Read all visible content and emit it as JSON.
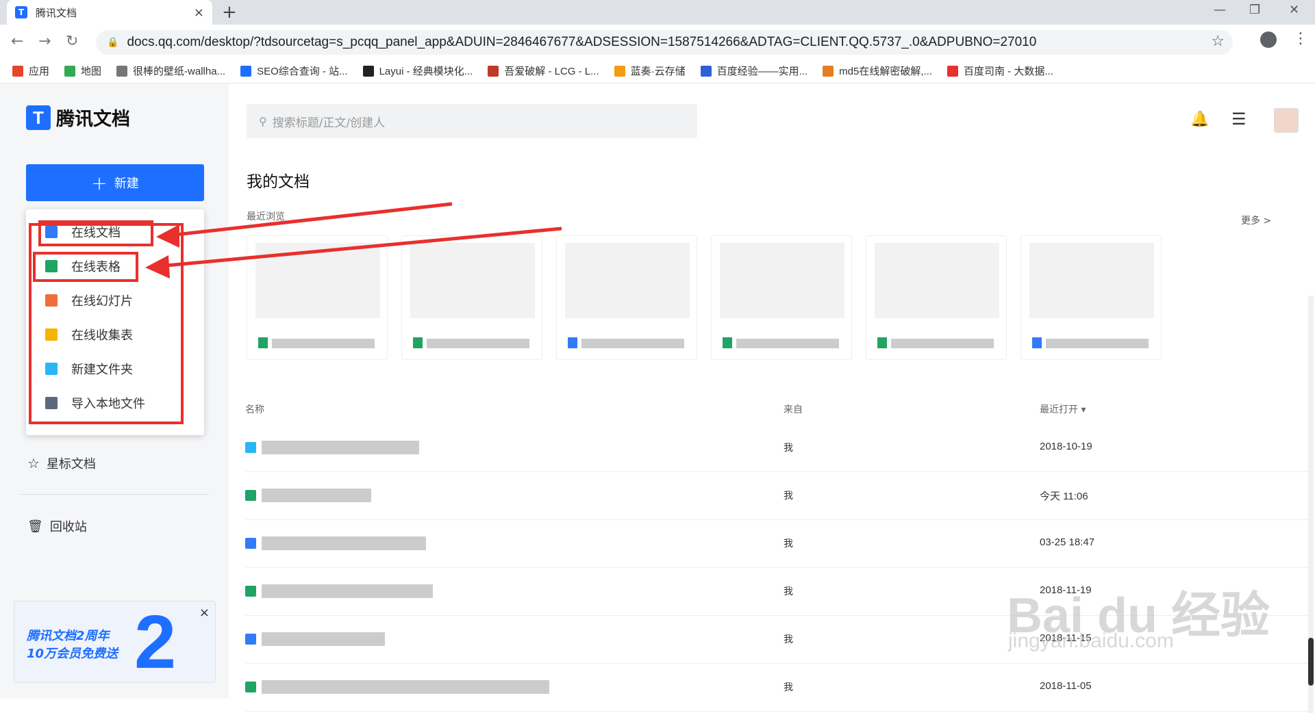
{
  "browser": {
    "tab_title": "腾讯文档",
    "tab_close": "×",
    "new_tab": "+",
    "url": "docs.qq.com/desktop/?tdsourcetag=s_pcqq_panel_app&ADUIN=2846467677&ADSESSION=1587514266&ADTAG=CLIENT.QQ.5737_.0&ADPUBNO=27010",
    "bookmarks": [
      {
        "label": "应用",
        "color": "#e8442c"
      },
      {
        "label": "地图",
        "color": "#34a853"
      },
      {
        "label": "很棒的壁纸-wallha...",
        "color": "#777777"
      },
      {
        "label": "SEO综合查询 - 站...",
        "color": "#1e6fff"
      },
      {
        "label": "Layui - 经典模块化...",
        "color": "#222222"
      },
      {
        "label": "吾爱破解 - LCG - L...",
        "color": "#c0392b"
      },
      {
        "label": "蓝奏·云存储",
        "color": "#f39c12"
      },
      {
        "label": "百度经验——实用...",
        "color": "#2f60d8"
      },
      {
        "label": "md5在线解密破解,...",
        "color": "#e67e22"
      },
      {
        "label": "百度司南 - 大数据...",
        "color": "#e8302c"
      }
    ]
  },
  "sidebar": {
    "logo": "腾讯文档",
    "new_button": "新建",
    "menu": [
      {
        "label": "在线文档",
        "color": "#2f7cf6"
      },
      {
        "label": "在线表格",
        "color": "#1fa463"
      },
      {
        "label": "在线幻灯片",
        "color": "#f26b3a"
      },
      {
        "label": "在线收集表",
        "color": "#f5b400"
      },
      {
        "label": "新建文件夹",
        "color": "#29b6f6"
      },
      {
        "label": "导入本地文件",
        "color": "#5a6a7a"
      }
    ],
    "starred": "星标文档",
    "trash": "回收站",
    "promo_line1": "腾讯文档2周年",
    "promo_line2": "10万会员免费送",
    "promo_close": "×"
  },
  "main": {
    "search_placeholder": "搜索标题/正文/创建人",
    "title": "我的文档",
    "recent": "最近浏览",
    "more": "更多 >",
    "columns": {
      "name": "名称",
      "from": "来自",
      "opened": "最近打开 ▾"
    },
    "recent_cards": [
      {
        "type_color": "#1fa463"
      },
      {
        "type_color": "#1fa463"
      },
      {
        "type_color": "#2f7cf6"
      },
      {
        "type_color": "#1fa463"
      },
      {
        "type_color": "#1fa463"
      },
      {
        "type_color": "#2f7cf6"
      }
    ],
    "rows": [
      {
        "from": "我",
        "date": "2018-10-19",
        "color": "#29b6f6"
      },
      {
        "from": "我",
        "date": "今天 11:06",
        "color": "#1fa463"
      },
      {
        "from": "我",
        "date": "03-25 18:47",
        "color": "#2f7cf6"
      },
      {
        "from": "我",
        "date": "2018-11-19",
        "color": "#1fa463"
      },
      {
        "from": "我",
        "date": "2018-11-15",
        "color": "#2f7cf6"
      },
      {
        "from": "我",
        "date": "2018-11-05",
        "color": "#1fa463"
      }
    ]
  },
  "watermark": {
    "line1": "Bai du 经验",
    "line2": "jingyan.baidu.com"
  }
}
